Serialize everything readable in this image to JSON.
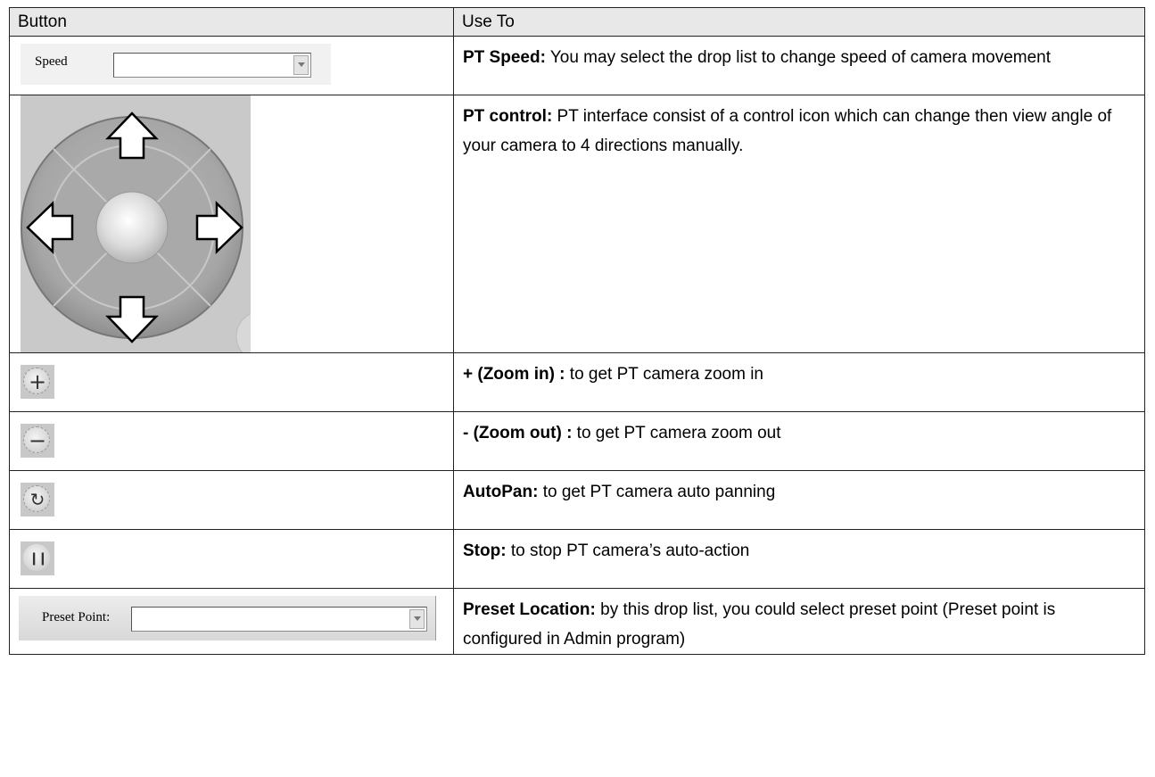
{
  "table": {
    "headers": [
      "Button",
      "Use To"
    ],
    "rows": [
      {
        "widget_label": "Speed",
        "title": "PT Speed:",
        "text": " You may select the drop list to change speed of camera movement",
        "icon": "speed-dropdown"
      },
      {
        "title": "PT control:",
        "text": " PT interface consist of a control icon which can change then view angle of your camera to 4 directions manually.",
        "icon": "direction-pad"
      },
      {
        "glyph": "+",
        "title": "+ (Zoom in) :",
        "text": " to get PT camera zoom in",
        "icon": "zoom-in-icon"
      },
      {
        "glyph": "−",
        "title": "- (Zoom out) :",
        "text": " to get PT camera zoom out",
        "icon": "zoom-out-icon"
      },
      {
        "glyph": "↻",
        "title": "AutoPan:",
        "text": " to get PT camera auto panning",
        "icon": "autopan-icon"
      },
      {
        "glyph": "❙❙",
        "title": "Stop:",
        "text": " to stop PT camera’s auto-action",
        "icon": "pause-icon"
      },
      {
        "widget_label": "Preset Point:",
        "title": "Preset Location:",
        "text": " by this drop list, you could select preset point (Preset point is configured in Admin program)",
        "icon": "preset-dropdown"
      }
    ]
  }
}
